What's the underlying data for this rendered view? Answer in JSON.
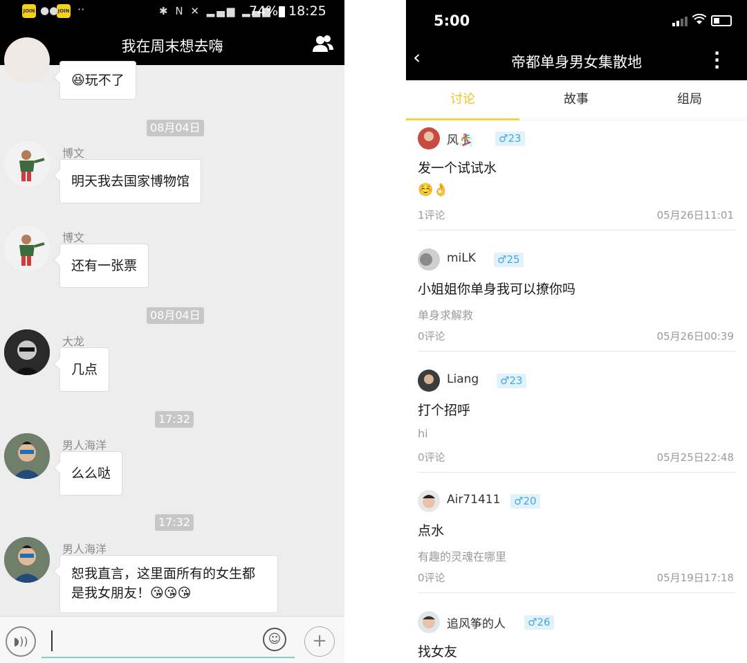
{
  "left_phone": {
    "statusbar": {
      "app_badge": "JOIN",
      "wechat_icon": "wechat-icon",
      "dots": "··",
      "battery": "74%",
      "time": "18:25"
    },
    "navbar": {
      "back_icon": "‹",
      "title": "我在周末想去嗨",
      "members_icon": "group-members-icon"
    },
    "messages": [
      {
        "type": "bubble",
        "sender": "",
        "text": "😆玩不了"
      },
      {
        "type": "time",
        "text": "08月04日"
      },
      {
        "type": "bubble",
        "sender": "博文",
        "text": "明天我去国家博物馆"
      },
      {
        "type": "bubble",
        "sender": "博文",
        "text": "还有一张票"
      },
      {
        "type": "time",
        "text": "08月04日"
      },
      {
        "type": "bubble",
        "sender": "大龙",
        "text": "几点"
      },
      {
        "type": "time",
        "text": "17:32"
      },
      {
        "type": "bubble",
        "sender": "男人海洋",
        "text": "么么哒"
      },
      {
        "type": "time",
        "text": "17:32"
      },
      {
        "type": "bubble",
        "sender": "男人海洋",
        "line1": "恕我直言，这里面所有的女生都",
        "line2": "是我女朋友！😘😘😘"
      }
    ],
    "inputbar": {
      "voice_icon": "voice-icon",
      "emoji_icon": "emoji-icon",
      "plus_icon": "plus-icon"
    }
  },
  "right_phone": {
    "statusbar": {
      "time": "5:00"
    },
    "header": {
      "back_icon": "‹",
      "title": "帝都单身男女集散地",
      "more_icon": "⋮"
    },
    "tabs": [
      {
        "label": "讨论",
        "active": true
      },
      {
        "label": "故事",
        "active": false
      },
      {
        "label": "组局",
        "active": false
      }
    ],
    "accent_color": "#f2c31b",
    "badge_color": "#45a9dc",
    "posts": [
      {
        "name": "风🏂",
        "badge": "♂23",
        "title": "发一个试试水",
        "body": "☺️👌",
        "comments": "1评论",
        "time": "05月26日11:01"
      },
      {
        "name": "miLK",
        "badge": "♂25",
        "title": "小姐姐你单身我可以撩你吗",
        "body": "单身求解救",
        "comments": "0评论",
        "time": "05月26日00:39"
      },
      {
        "name": "Liang",
        "badge": "♂23",
        "title": "打个招呼",
        "body": "hi",
        "comments": "0评论",
        "time": "05月25日22:48"
      },
      {
        "name": "Air71411",
        "badge": "♂20",
        "title": "点水",
        "body": "有趣的灵魂在哪里",
        "comments": "0评论",
        "time": "05月19日17:18"
      },
      {
        "name": "追风筝的人",
        "badge": "♂26",
        "title": "找女友",
        "body": "",
        "comments": "",
        "time": ""
      }
    ]
  }
}
